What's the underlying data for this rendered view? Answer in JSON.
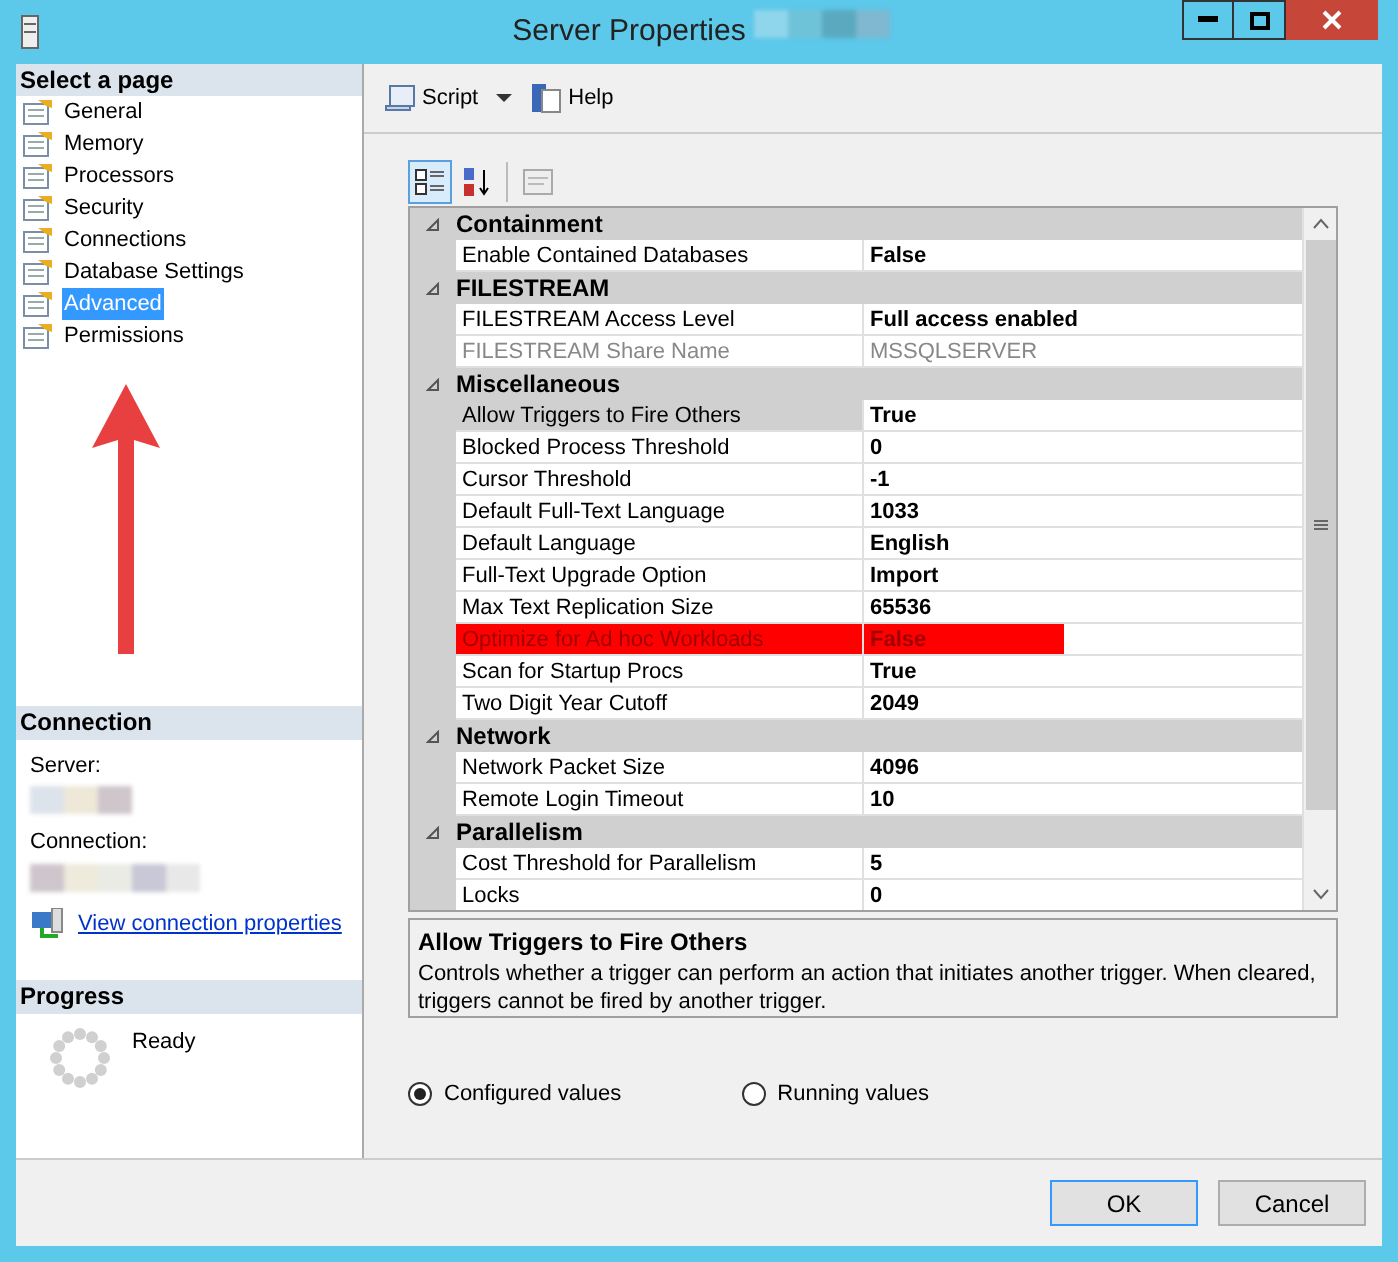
{
  "window": {
    "title": "Server Properties"
  },
  "sidebar": {
    "header": "Select a page",
    "items": [
      {
        "label": "General",
        "selected": false
      },
      {
        "label": "Memory",
        "selected": false
      },
      {
        "label": "Processors",
        "selected": false
      },
      {
        "label": "Security",
        "selected": false
      },
      {
        "label": "Connections",
        "selected": false
      },
      {
        "label": "Database Settings",
        "selected": false
      },
      {
        "label": "Advanced",
        "selected": true
      },
      {
        "label": "Permissions",
        "selected": false
      }
    ]
  },
  "connection": {
    "header": "Connection",
    "server_label": "Server:",
    "connection_label": "Connection:",
    "link": "View connection properties"
  },
  "progress": {
    "header": "Progress",
    "status": "Ready"
  },
  "toolbar": {
    "script": "Script",
    "help": "Help"
  },
  "grid": {
    "rows": [
      {
        "kind": "category",
        "name": "Containment",
        "expanded": true
      },
      {
        "kind": "property",
        "name": "Enable Contained Databases",
        "value": "False",
        "selected": false,
        "disabled": false,
        "highlighted": false
      },
      {
        "kind": "category",
        "name": "FILESTREAM",
        "expanded": true
      },
      {
        "kind": "property",
        "name": "FILESTREAM Access Level",
        "value": "Full access enabled",
        "selected": false,
        "disabled": false,
        "highlighted": false
      },
      {
        "kind": "property",
        "name": "FILESTREAM Share Name",
        "value": "MSSQLSERVER",
        "selected": false,
        "disabled": true,
        "highlighted": false
      },
      {
        "kind": "category",
        "name": "Miscellaneous",
        "expanded": true
      },
      {
        "kind": "property",
        "name": "Allow Triggers to Fire Others",
        "value": "True",
        "selected": true,
        "disabled": false,
        "highlighted": false
      },
      {
        "kind": "property",
        "name": "Blocked Process Threshold",
        "value": "0",
        "selected": false,
        "disabled": false,
        "highlighted": false
      },
      {
        "kind": "property",
        "name": "Cursor Threshold",
        "value": "-1",
        "selected": false,
        "disabled": false,
        "highlighted": false
      },
      {
        "kind": "property",
        "name": "Default Full-Text Language",
        "value": "1033",
        "selected": false,
        "disabled": false,
        "highlighted": false
      },
      {
        "kind": "property",
        "name": "Default Language",
        "value": "English",
        "selected": false,
        "disabled": false,
        "highlighted": false
      },
      {
        "kind": "property",
        "name": "Full-Text Upgrade Option",
        "value": "Import",
        "selected": false,
        "disabled": false,
        "highlighted": false
      },
      {
        "kind": "property",
        "name": "Max Text Replication Size",
        "value": "65536",
        "selected": false,
        "disabled": false,
        "highlighted": false
      },
      {
        "kind": "property",
        "name": "Optimize for Ad hoc Workloads",
        "value": "False",
        "selected": false,
        "disabled": false,
        "highlighted": true
      },
      {
        "kind": "property",
        "name": "Scan for Startup Procs",
        "value": "True",
        "selected": false,
        "disabled": false,
        "highlighted": false
      },
      {
        "kind": "property",
        "name": "Two Digit Year Cutoff",
        "value": "2049",
        "selected": false,
        "disabled": false,
        "highlighted": false
      },
      {
        "kind": "category",
        "name": "Network",
        "expanded": true
      },
      {
        "kind": "property",
        "name": "Network Packet Size",
        "value": "4096",
        "selected": false,
        "disabled": false,
        "highlighted": false
      },
      {
        "kind": "property",
        "name": "Remote Login Timeout",
        "value": "10",
        "selected": false,
        "disabled": false,
        "highlighted": false
      },
      {
        "kind": "category",
        "name": "Parallelism",
        "expanded": true
      },
      {
        "kind": "property",
        "name": "Cost Threshold for Parallelism",
        "value": "5",
        "selected": false,
        "disabled": false,
        "highlighted": false
      },
      {
        "kind": "property",
        "name": "Locks",
        "value": "0",
        "selected": false,
        "disabled": false,
        "highlighted": false
      }
    ]
  },
  "description": {
    "title": "Allow Triggers to Fire Others",
    "text": "Controls whether a trigger can perform an action that initiates another trigger. When cleared, triggers cannot be fired by another trigger."
  },
  "view_options": [
    {
      "label": "Configured values",
      "selected": true
    },
    {
      "label": "Running values",
      "selected": false
    }
  ],
  "buttons": [
    "OK",
    "Cancel"
  ]
}
